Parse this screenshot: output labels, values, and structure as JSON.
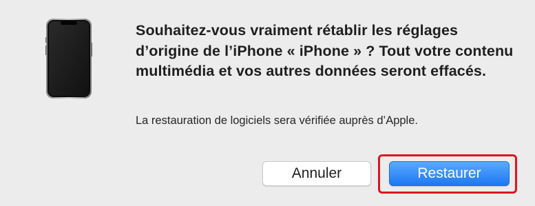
{
  "dialog": {
    "icon": "iphone-device-icon",
    "headline": "Souhaitez-vous vraiment rétablir les réglages d’origine de l’iPhone « iPhone » ? Tout votre contenu multimédia et vos autres données seront effacés.",
    "subtext": "La restauration de logiciels sera vérifiée auprès d’Apple.",
    "buttons": {
      "cancel_label": "Annuler",
      "restore_label": "Restaurer"
    }
  },
  "colors": {
    "background": "#ececec",
    "primary_button": "#1d78f2",
    "highlight_box": "#e0141e"
  }
}
